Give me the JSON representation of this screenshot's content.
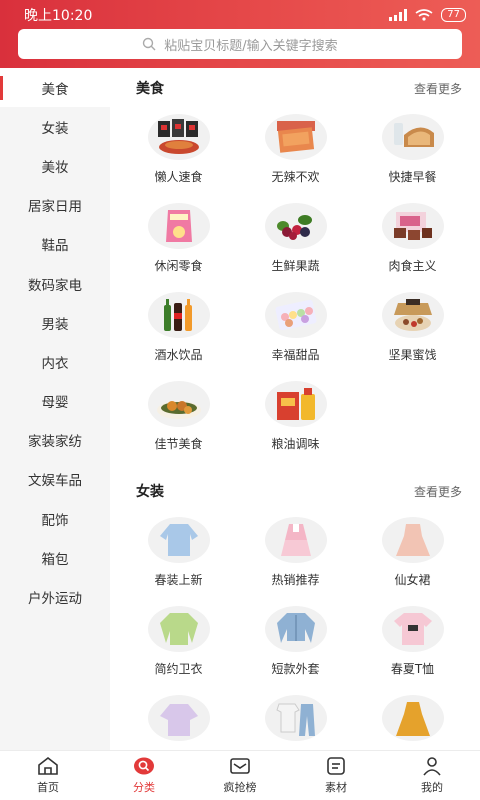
{
  "status": {
    "time": "晚上10:20",
    "battery": "77"
  },
  "search": {
    "placeholder": "粘贴宝贝标题/输入关键字搜索"
  },
  "sidebar": {
    "items": [
      {
        "label": "美食"
      },
      {
        "label": "女装"
      },
      {
        "label": "美妆"
      },
      {
        "label": "居家日用"
      },
      {
        "label": "鞋品"
      },
      {
        "label": "数码家电"
      },
      {
        "label": "男装"
      },
      {
        "label": "内衣"
      },
      {
        "label": "母婴"
      },
      {
        "label": "家装家纺"
      },
      {
        "label": "文娱车品"
      },
      {
        "label": "配饰"
      },
      {
        "label": "箱包"
      },
      {
        "label": "户外运动"
      }
    ],
    "active": "美食"
  },
  "sections": [
    {
      "title": "美食",
      "more": "查看更多",
      "items": [
        {
          "label": "懒人速食",
          "icon": "instant-food"
        },
        {
          "label": "无辣不欢",
          "icon": "spicy-snack"
        },
        {
          "label": "快捷早餐",
          "icon": "bread"
        },
        {
          "label": "休闲零食",
          "icon": "snack-bag"
        },
        {
          "label": "生鲜果蔬",
          "icon": "berries"
        },
        {
          "label": "肉食主义",
          "icon": "meat-box"
        },
        {
          "label": "酒水饮品",
          "icon": "bottles"
        },
        {
          "label": "幸福甜品",
          "icon": "macarons"
        },
        {
          "label": "坚果蜜饯",
          "icon": "nuts"
        },
        {
          "label": "佳节美食",
          "icon": "dumplings"
        },
        {
          "label": "粮油调味",
          "icon": "oil-rice"
        }
      ]
    },
    {
      "title": "女装",
      "more": "查看更多",
      "items": [
        {
          "label": "春装上新",
          "icon": "blouse"
        },
        {
          "label": "热销推荐",
          "icon": "pink-outfit"
        },
        {
          "label": "仙女裙",
          "icon": "dress"
        },
        {
          "label": "简约卫衣",
          "icon": "sweatshirt"
        },
        {
          "label": "短款外套",
          "icon": "denim-jacket"
        },
        {
          "label": "春夏T恤",
          "icon": "tshirt"
        },
        {
          "label": "",
          "icon": "lilac-top"
        },
        {
          "label": "",
          "icon": "tee-jeans"
        },
        {
          "label": "",
          "icon": "orange-dress"
        }
      ]
    }
  ],
  "bottom_nav": [
    {
      "label": "首页",
      "icon": "home-icon"
    },
    {
      "label": "分类",
      "icon": "category-search-icon"
    },
    {
      "label": "疯抢榜",
      "icon": "ranking-icon"
    },
    {
      "label": "素材",
      "icon": "material-icon"
    },
    {
      "label": "我的",
      "icon": "profile-icon"
    }
  ],
  "colors": {
    "brand": "#e23a3a",
    "sidebar_bg": "#f5f5f5"
  }
}
